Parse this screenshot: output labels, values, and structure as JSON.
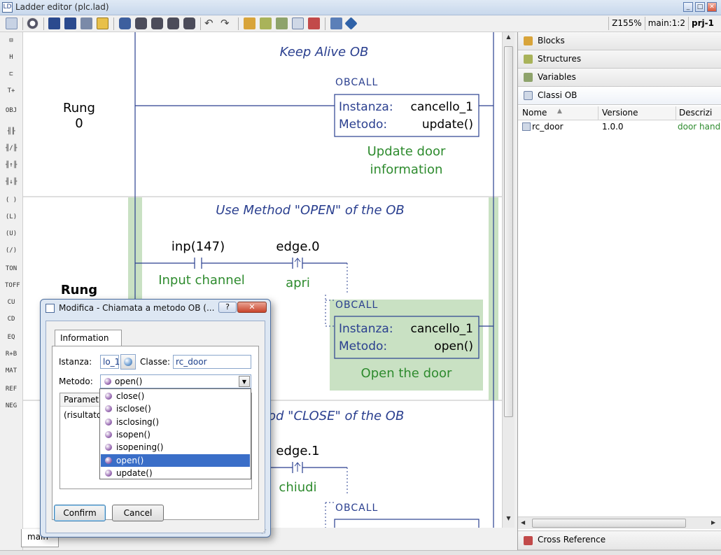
{
  "window": {
    "title": "Ladder editor (plc.lad)",
    "icon_glyph": "LD",
    "controls": [
      "_",
      "□",
      "✕"
    ]
  },
  "toolbar": {
    "zoom": "Z155%",
    "position": "main:1:2",
    "project": "prj-1"
  },
  "rungs": [
    {
      "label": "Rung",
      "number": "0",
      "comment": "Keep Alive OB",
      "block_header": "OBCALL",
      "instance_label": "Instanza:",
      "instance_value": "cancello_1",
      "method_label": "Metodo:",
      "method_value": "update()",
      "block_comment_1": "Update door",
      "block_comment_2": "information"
    },
    {
      "label": "Rung",
      "comment": "Use Method \"OPEN\" of the OB",
      "contact_1_name": "inp(147)",
      "contact_1_comment": "Input channel",
      "contact_2_name": "edge.0",
      "contact_2_comment": "apri",
      "block_header": "OBCALL",
      "instance_label": "Instanza:",
      "instance_value": "cancello_1",
      "method_label": "Metodo:",
      "method_value": "open()",
      "block_comment": "Open the door"
    },
    {
      "comment_partial": "od \"CLOSE\" of the OB",
      "contact_2_name": "edge.1",
      "contact_2_comment": "chiudi",
      "block_header": "OBCALL"
    }
  ],
  "bottom_tabs": [
    "main"
  ],
  "right_panel": {
    "tabs": [
      "Blocks",
      "Structures",
      "Variables",
      "Classi OB"
    ],
    "columns": [
      "Nome",
      "Versione",
      "Descrizi"
    ],
    "rows": [
      {
        "name": "rc_door",
        "version": "1.0.0",
        "description": "door hand"
      }
    ],
    "bottom_tab": "Cross Reference"
  },
  "dialog": {
    "title": "Modifica - Chiamata a metodo OB (...",
    "help_glyph": "?",
    "close_glyph": "✕",
    "tab": "Information",
    "istanza_label": "Istanza:",
    "istanza_value": "lo_1",
    "classe_label": "Classe:",
    "classe_value": "rc_door",
    "metodo_label": "Metodo:",
    "metodo_value": "open()",
    "params_header": "Parametri",
    "params_row": "(risultato)",
    "confirm": "Confirm",
    "cancel": "Cancel",
    "method_options": [
      "close()",
      "isclose()",
      "isclosing()",
      "isopen()",
      "isopening()",
      "open()",
      "update()"
    ],
    "selected_option": "open()"
  },
  "left_tools": [
    "⊟",
    "H",
    "⊏",
    "T+",
    "OBJ",
    "╢╟",
    "╢/╟",
    "╢↑╟",
    "╢↓╟",
    "( )",
    "(L)",
    "(U)",
    "(/)",
    "TON",
    "TOFF",
    "CU",
    "CD",
    "EQ",
    "R+B",
    "MAT",
    "REF",
    "NEG"
  ],
  "colors": {
    "ladder_line": "#2a3f8f",
    "comment_green": "#2e8b2e",
    "selected_rung": "#c9e1c3",
    "selection_blue": "#3a6ec8"
  }
}
